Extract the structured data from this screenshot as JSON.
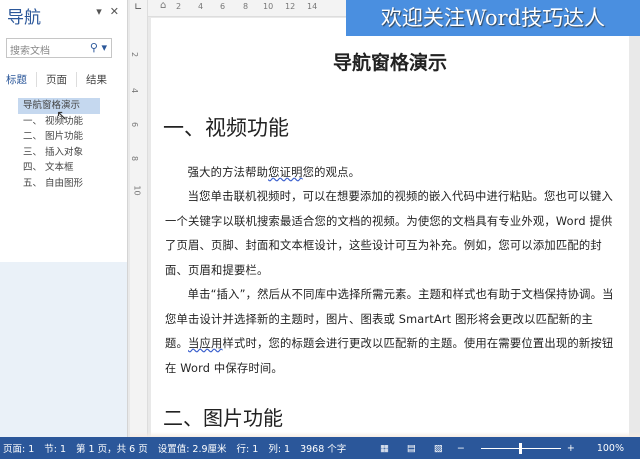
{
  "nav": {
    "title": "导航",
    "search_placeholder": "搜索文档",
    "tabs": [
      "标题",
      "页面",
      "结果"
    ],
    "headings": [
      {
        "num": "",
        "label": "导航窗格演示"
      },
      {
        "num": "一、",
        "label": "视频功能"
      },
      {
        "num": "二、",
        "label": "图片功能"
      },
      {
        "num": "三、",
        "label": "插入对象"
      },
      {
        "num": "四、",
        "label": "文本框"
      },
      {
        "num": "五、",
        "label": "自由图形"
      }
    ]
  },
  "ruler": {
    "h": [
      "2",
      "4",
      "6",
      "8",
      "10",
      "12",
      "14"
    ],
    "v": [
      "2",
      "4",
      "6",
      "8",
      "10"
    ]
  },
  "banner": "欢迎关注Word技巧达人",
  "doc": {
    "title": "导航窗格演示",
    "h1": "一、视频功能",
    "h2": "二、图片功能",
    "p1a": "强大的方法帮助",
    "p1b": "您证明",
    "p1c": "您的观点。",
    "p2": "当您单击联机视频时，可以在想要添加的视频的嵌入代码中进行粘贴。您也可以键入一个关键字以联机搜索最适合您的文档的视频。为使您的文档具有专业外观，Word 提供了页眉、页脚、封面和文本框设计，这些设计可互为补充。例如，您可以添加匹配的封面、页眉和提要栏。",
    "p3a": "单击“插入”，然后从不同库中选择所需元素。主题和样式也有助于文档保持协调。当您单击设计并选择新的主题时，图片、图表或 SmartArt 图形将会更改以匹配新的主题。",
    "p3b": "当应用",
    "p3c": "样式时，您的标题会进行更改以匹配新的主题。使用在需要位置出现的新按钮在 Word 中保存时间。"
  },
  "status": {
    "page": "页面: 1",
    "section": "节: 1",
    "pages": "第 1 页，共 6 页",
    "setting": "设置值: 2.9厘米",
    "row": "行: 1",
    "col": "列: 1",
    "words": "3968 个字",
    "zoom": "100%",
    "zoom_level": 100
  },
  "colors": {
    "accent": "#2b579a",
    "banner": "#4a8fe0"
  }
}
